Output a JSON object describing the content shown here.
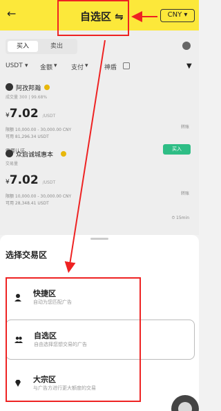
{
  "header": {
    "back_icon": "arrow-left-icon",
    "title": "自选区",
    "swap_icon": "swap-icon",
    "currency": "CNY ▾"
  },
  "tabs": {
    "buy": "买入",
    "sell": "卖出"
  },
  "filters": {
    "coin": "USDT",
    "amount": "金额",
    "payment": "支付",
    "merchant": "神盾"
  },
  "listings": [
    {
      "name": "阿孜邦瀚",
      "sub": "成交量 300 | 99.68%",
      "price_symbol": "¥",
      "price": "7.02",
      "price_unit": "/USDT",
      "limit": "限额 10,000.00 - 30,000.00 CNY",
      "quantity": "可用 81,296.34 USDT",
      "auth": "需要认证",
      "right_top": "转账",
      "right_bottom": "",
      "buy_label": "买入"
    },
    {
      "name": "众启诚城惠本",
      "sub": "交易量",
      "price_symbol": "¥",
      "price": "7.02",
      "price_unit": "/USDT",
      "limit": "限额 10,000.00 - 30,000.00 CNY",
      "quantity": "可用 28,348.41 USDT",
      "auth": "",
      "right_top": "转账",
      "right_bottom": "15min",
      "buy_label": ""
    }
  ],
  "sheet": {
    "title": "选择交易区",
    "options": [
      {
        "title": "快捷区",
        "subtitle": "自动为您匹配广告",
        "icon": "user-icon"
      },
      {
        "title": "自选区",
        "subtitle": "自由选择您想交易的广告",
        "icon": "users-icon"
      },
      {
        "title": "大宗区",
        "subtitle": "与广告方进行更大额度的交易",
        "icon": "diamond-icon"
      }
    ]
  },
  "colors": {
    "brand_yellow": "#fce83a",
    "buy_green": "#2ebd85",
    "annotation_red": "#e22222"
  }
}
